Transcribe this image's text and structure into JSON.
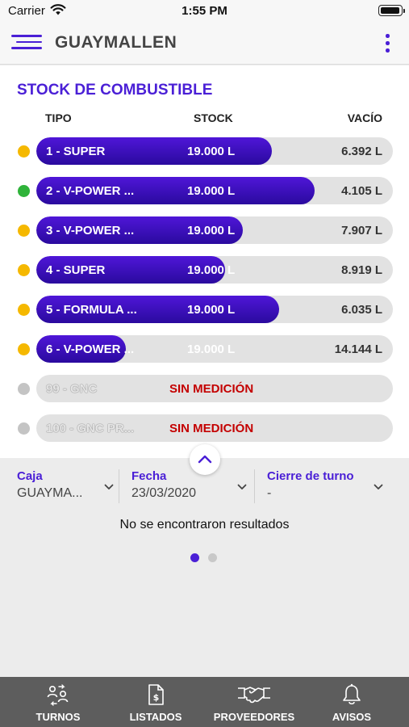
{
  "status": {
    "carrier": "Carrier",
    "time": "1:55 PM"
  },
  "header": {
    "title": "GUAYMALLEN"
  },
  "stock": {
    "title": "STOCK DE COMBUSTIBLE",
    "col_tipo": "TIPO",
    "col_stock": "STOCK",
    "col_vacio": "VACÍO",
    "tanks": [
      {
        "name": "1 - SUPER",
        "stock": "19.000 L",
        "empty": "6.392 L",
        "fill_pct": 66,
        "status_color": "#f5b800"
      },
      {
        "name": "2 - V-POWER ...",
        "stock": "19.000 L",
        "empty": "4.105 L",
        "fill_pct": 78,
        "status_color": "#2fb33a"
      },
      {
        "name": "3 - V-POWER ...",
        "stock": "19.000 L",
        "empty": "7.907 L",
        "fill_pct": 58,
        "status_color": "#f5b800"
      },
      {
        "name": "4 - SUPER",
        "stock": "19.000 L",
        "empty": "8.919 L",
        "fill_pct": 53,
        "status_color": "#f5b800"
      },
      {
        "name": "5 - FORMULA ...",
        "stock": "19.000 L",
        "empty": "6.035 L",
        "fill_pct": 68,
        "status_color": "#f5b800"
      },
      {
        "name": "6 - V-POWER ...",
        "stock": "19.000 L",
        "empty": "14.144 L",
        "fill_pct": 25,
        "status_color": "#f5b800"
      },
      {
        "name": "99 - GNC",
        "no_measure": "SIN MEDICIÓN",
        "status_color": "#c4c4c4"
      },
      {
        "name": "100 - GNC PR...",
        "no_measure": "SIN MEDICIÓN",
        "status_color": "#c4c4c4"
      }
    ]
  },
  "filters": {
    "caja": {
      "label": "Caja",
      "value": "GUAYMA..."
    },
    "fecha": {
      "label": "Fecha",
      "value": "23/03/2020"
    },
    "cierre": {
      "label": "Cierre de turno",
      "value": "-"
    }
  },
  "results": {
    "empty_message": "No se encontraron resultados"
  },
  "pager": {
    "pages": 2,
    "current": 1
  },
  "tabs": [
    {
      "label": "TURNOS",
      "icon": "shifts-icon",
      "active": true
    },
    {
      "label": "LISTADOS",
      "icon": "document-dollar-icon",
      "active": false
    },
    {
      "label": "PROVEEDORES",
      "icon": "handshake-icon",
      "active": false
    },
    {
      "label": "AVISOS",
      "icon": "bell-icon",
      "active": false
    }
  ],
  "colors": {
    "accent": "#4a1fd6",
    "alert": "#c40000",
    "tabbar": "#5d5d5d"
  }
}
